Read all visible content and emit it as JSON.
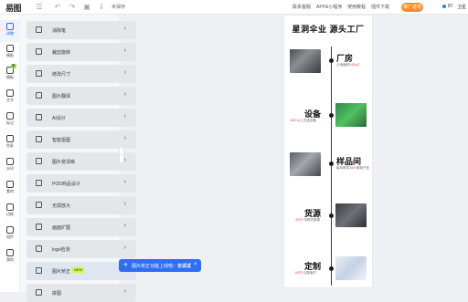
{
  "topbar": {
    "logo": "易图",
    "unsaved": "未保存",
    "nav": [
      "联系客服",
      "APP&小程序",
      "使用教程",
      "插件下载"
    ],
    "vip_label": "推广返现",
    "user_level": "87",
    "user_name": "卫星"
  },
  "rail": [
    {
      "label": "调整",
      "icon": "adjust-icon",
      "active": true
    },
    {
      "label": "模板",
      "icon": "template-icon"
    },
    {
      "label": "模板",
      "icon": "layout-icon",
      "badge": "新"
    },
    {
      "label": "文字",
      "icon": "text-icon"
    },
    {
      "label": "标记",
      "icon": "mark-icon"
    },
    {
      "label": "色彩",
      "icon": "color-icon"
    },
    {
      "label": "水印",
      "icon": "watermark-icon"
    },
    {
      "label": "素材",
      "icon": "material-icon"
    },
    {
      "label": "边框",
      "icon": "border-icon"
    },
    {
      "label": "组件",
      "icon": "component-icon"
    },
    {
      "label": "我的",
      "icon": "my-icon"
    }
  ],
  "tools": [
    {
      "label": "消除笔",
      "icon": "eraser-icon"
    },
    {
      "label": "裁剪旋转",
      "icon": "crop-icon"
    },
    {
      "label": "修改尺寸",
      "icon": "resize-icon"
    },
    {
      "label": "图片翻译",
      "icon": "translate-icon"
    },
    {
      "label": "AI设计",
      "icon": "ai-design-icon"
    },
    {
      "label": "智能抠图",
      "icon": "cutout-icon"
    },
    {
      "label": "图片变清晰",
      "icon": "sharpen-icon"
    },
    {
      "label": "POD商品设计",
      "icon": "pod-icon"
    },
    {
      "label": "无损放大",
      "icon": "upscale-icon"
    },
    {
      "label": "画面扩图",
      "icon": "expand-icon"
    },
    {
      "label": "logo检测",
      "icon": "logo-detect-icon"
    },
    {
      "label": "图片矫正",
      "icon": "correct-icon",
      "tag": "NEW",
      "highlight": true
    },
    {
      "label": "拼图",
      "icon": "collage-icon"
    }
  ],
  "toast": {
    "text": "图片校正功能上线啦~",
    "action": "去试试"
  },
  "poster": {
    "title": "星洞伞业 源头工厂",
    "sections": [
      {
        "title": "厂房",
        "sub_pre": "占地面积",
        "sub_highlight": "2400㎡",
        "sub_post": ""
      },
      {
        "title": "设备",
        "sub_pre": "",
        "sub_highlight": "100+",
        "sub_post": "以上先进设备"
      },
      {
        "title": "样品间",
        "sub_pre": "每年研发",
        "sub_highlight": "300+",
        "sub_post": "款新产品"
      },
      {
        "title": "货源",
        "sub_pre": "",
        "sub_highlight": "40万+",
        "sub_post": "伞现货资源"
      },
      {
        "title": "定制",
        "sub_pre": "",
        "sub_highlight": "60万+",
        "sub_post": "定制客户"
      }
    ]
  }
}
